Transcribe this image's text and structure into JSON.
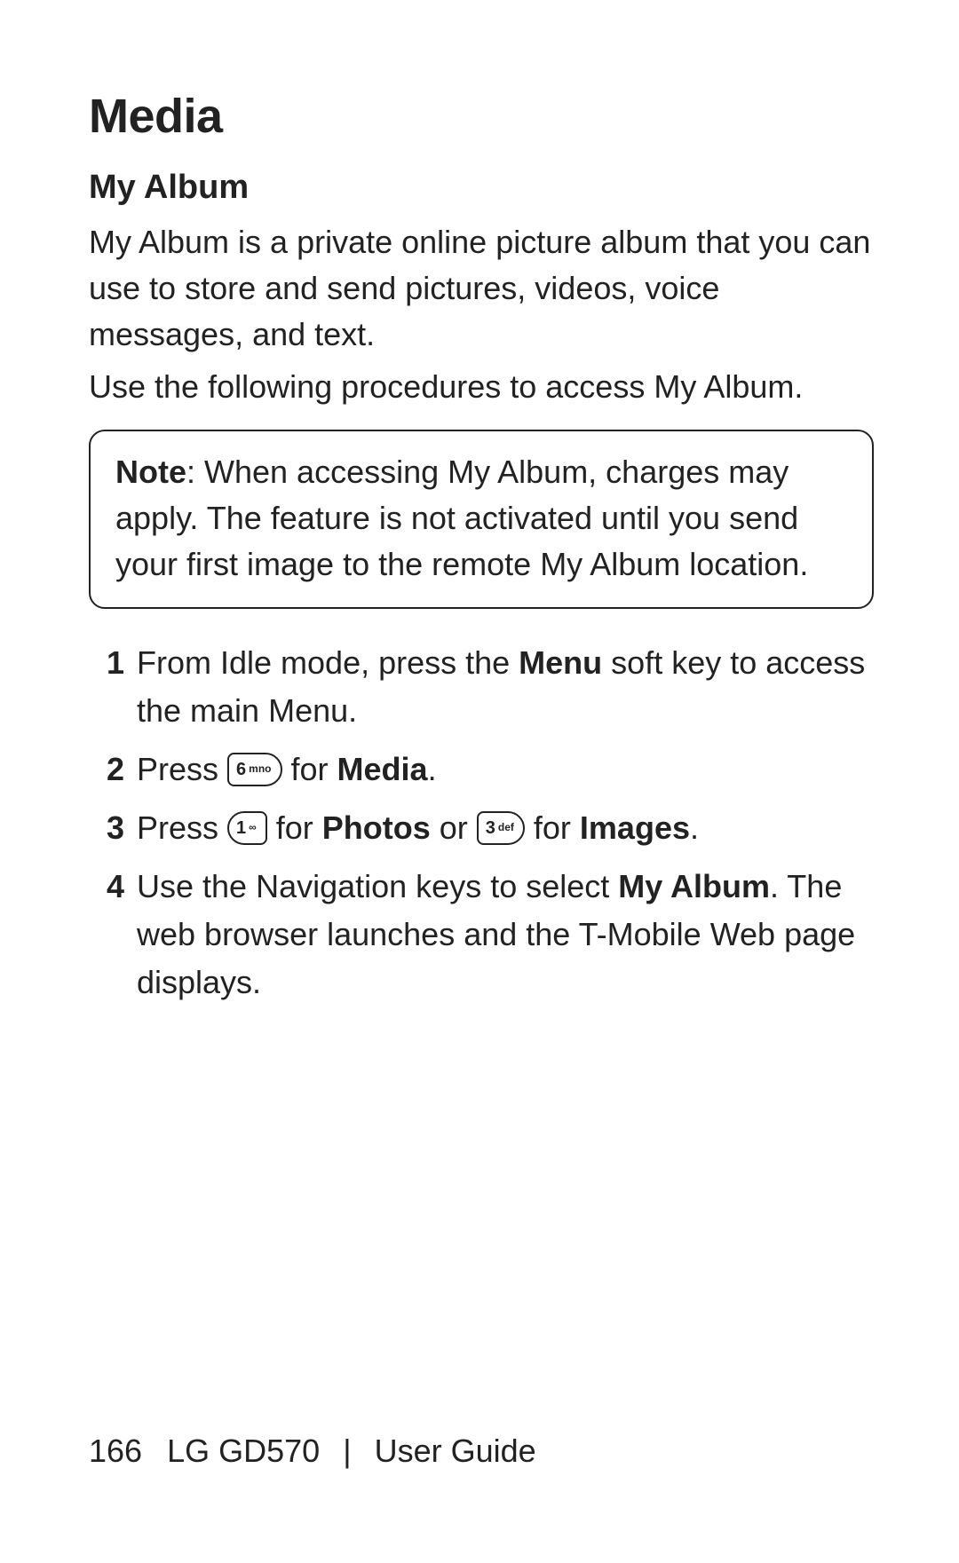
{
  "title": "Media",
  "subtitle": "My Album",
  "intro": {
    "p1": "My Album is a private online picture album that you can use to store and send pictures, videos, voice messages, and text.",
    "p2": "Use the following procedures to access My Album."
  },
  "note": {
    "label": "Note",
    "body": ": When accessing My Album, charges may apply. The feature is not activated until you send your first image to the remote My Album location."
  },
  "keys": {
    "k6": {
      "main": "6",
      "sub": "mno"
    },
    "k1": {
      "main": "1",
      "sub": "∞"
    },
    "k3": {
      "main": "3",
      "sub": "def"
    }
  },
  "steps": {
    "s1_a": "From Idle mode, press the ",
    "s1_menu": "Menu",
    "s1_b": " soft key to access the main Menu.",
    "s2_a": "Press ",
    "s2_for": " for ",
    "s2_media": "Media",
    "s2_end": ".",
    "s3_a": "Press ",
    "s3_for1": " for ",
    "s3_photos": "Photos",
    "s3_or": " or ",
    "s3_for2": " for ",
    "s3_images": "Images",
    "s3_end": ".",
    "s4_a": "Use the Navigation keys to select ",
    "s4_myalbum": "My Album",
    "s4_b": ". The web browser launches and the T-Mobile Web page displays."
  },
  "footer": {
    "page": "166",
    "product": "LG GD570",
    "separator": "|",
    "guide": "User Guide"
  }
}
